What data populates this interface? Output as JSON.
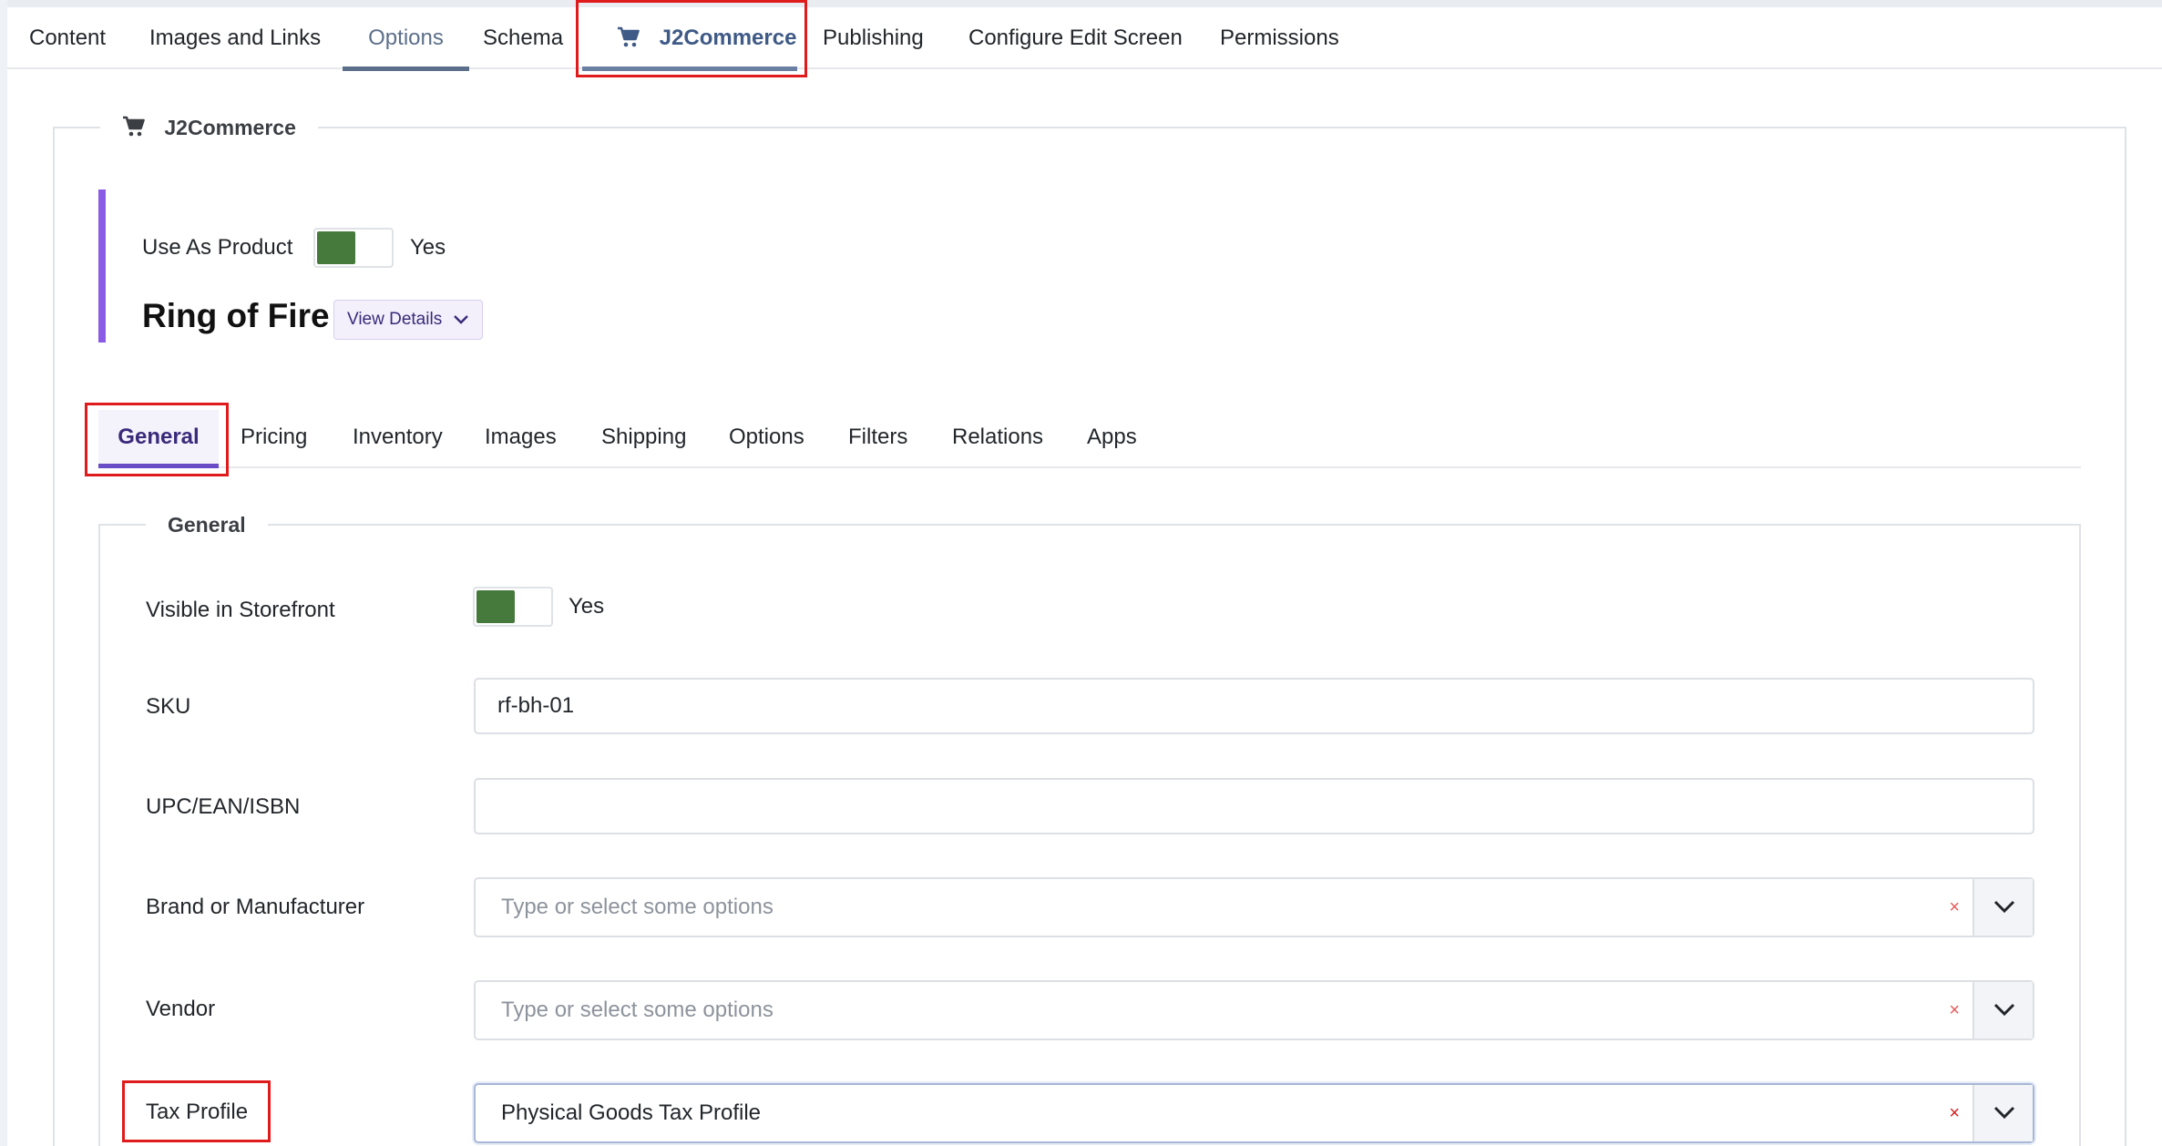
{
  "top_tabs": [
    {
      "label": "Content"
    },
    {
      "label": "Images and Links"
    },
    {
      "label": "Options"
    },
    {
      "label": "Schema"
    },
    {
      "label": "J2Commerce",
      "icon": "cart-icon"
    },
    {
      "label": "Publishing"
    },
    {
      "label": "Configure Edit Screen"
    },
    {
      "label": "Permissions"
    }
  ],
  "section": {
    "legend": "J2Commerce",
    "icon": "cart-icon"
  },
  "product": {
    "use_as_product_label": "Use As Product",
    "use_as_product_state": "Yes",
    "title": "Ring of Fire",
    "view_details_label": "View Details"
  },
  "inner_tabs": [
    {
      "label": "General"
    },
    {
      "label": "Pricing"
    },
    {
      "label": "Inventory"
    },
    {
      "label": "Images"
    },
    {
      "label": "Shipping"
    },
    {
      "label": "Options"
    },
    {
      "label": "Filters"
    },
    {
      "label": "Relations"
    },
    {
      "label": "Apps"
    }
  ],
  "general": {
    "legend": "General",
    "visible_label": "Visible in Storefront",
    "visible_state": "Yes",
    "sku_label": "SKU",
    "sku_value": "rf-bh-01",
    "upc_label": "UPC/EAN/ISBN",
    "upc_value": "",
    "brand_label": "Brand or Manufacturer",
    "brand_placeholder": "Type or select some options",
    "vendor_label": "Vendor",
    "vendor_placeholder": "Type or select some options",
    "tax_label": "Tax Profile",
    "tax_value": "Physical Goods Tax Profile",
    "clear_glyph": "×"
  },
  "colors": {
    "toggle_on": "#467a3c",
    "accent_bar": "#8a5ce6",
    "highlight_box": "#e01b1b",
    "active_tab": "#6a4cc6"
  }
}
